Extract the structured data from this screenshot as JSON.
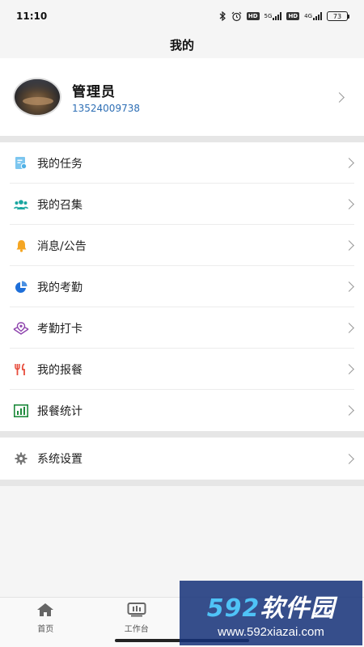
{
  "status_bar": {
    "time": "11:10",
    "net1": "5G",
    "net2": "4G",
    "hd": "HD",
    "battery": "73"
  },
  "header": {
    "title": "我的"
  },
  "profile": {
    "name": "管理员",
    "phone": "13524009738"
  },
  "menu": {
    "items": [
      {
        "label": "我的任务",
        "icon": "task-doc-icon",
        "color": "#4fb0e5"
      },
      {
        "label": "我的召集",
        "icon": "group-users-icon",
        "color": "#1aa6a0"
      },
      {
        "label": "消息/公告",
        "icon": "bell-icon",
        "color": "#f5a623"
      },
      {
        "label": "我的考勤",
        "icon": "pie-chart-icon",
        "color": "#1e6fd9"
      },
      {
        "label": "考勤打卡",
        "icon": "location-pin-icon",
        "color": "#8e44ad"
      },
      {
        "label": "我的报餐",
        "icon": "fork-knife-icon",
        "color": "#e74c3c"
      },
      {
        "label": "报餐统计",
        "icon": "bar-chart-icon",
        "color": "#1e8a3c"
      }
    ]
  },
  "settings": {
    "label": "系统设置",
    "icon": "gear-icon",
    "color": "#777777"
  },
  "tabs": [
    {
      "label": "首页",
      "icon": "home-icon"
    },
    {
      "label": "工作台",
      "icon": "monitor-icon"
    },
    {
      "label": "",
      "icon": "tab-icon-hidden"
    },
    {
      "label": "",
      "icon": "tab-icon-hidden"
    }
  ],
  "watermark": {
    "number": "592",
    "text": "软件园",
    "url": "www.592xiazai.com"
  }
}
